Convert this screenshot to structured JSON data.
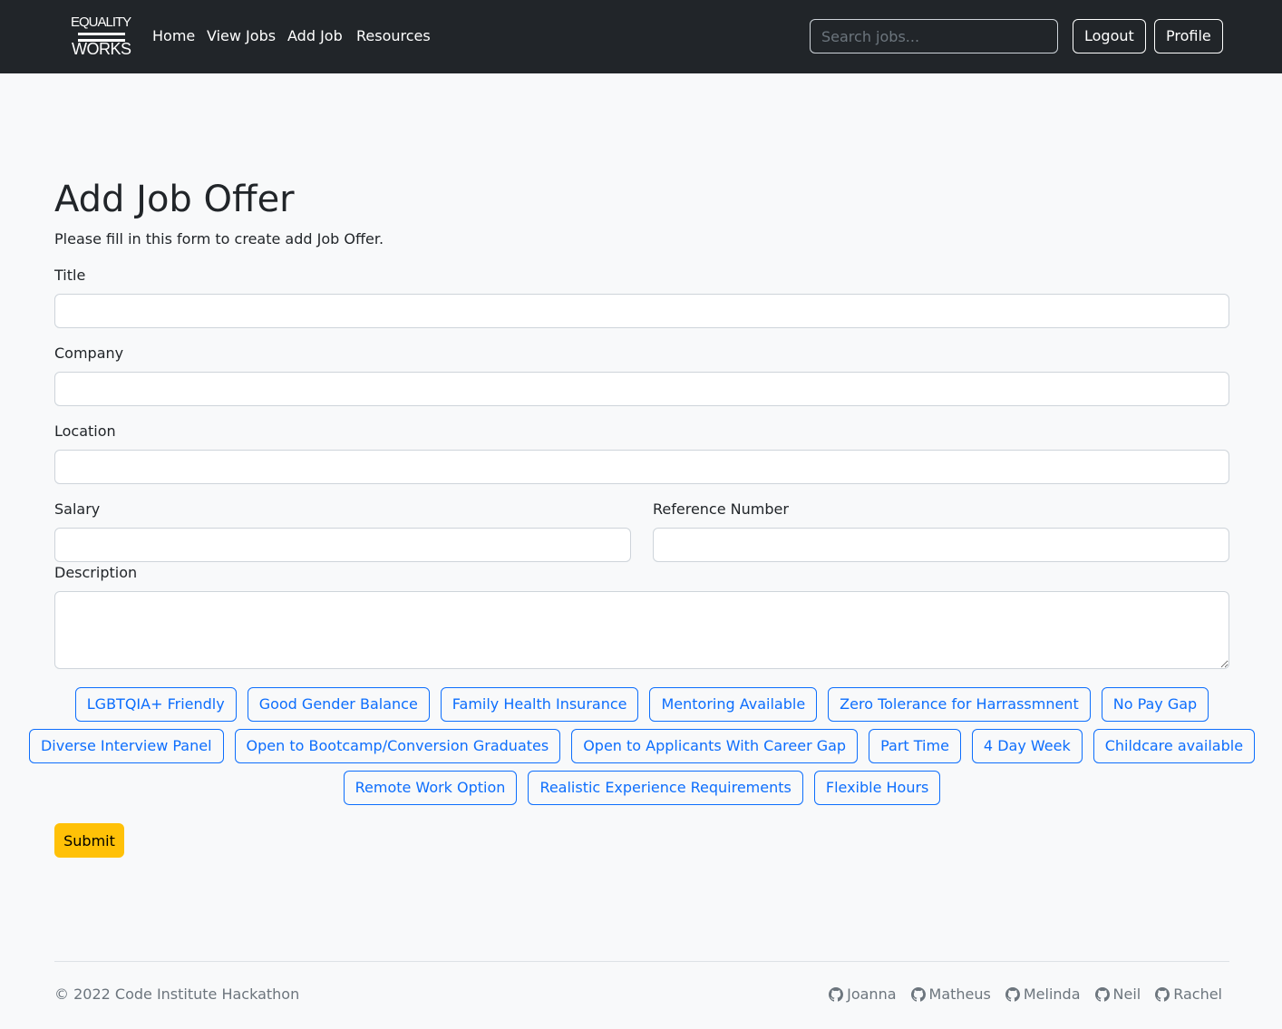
{
  "brand": {
    "line1": "EQUALITY",
    "line2": "WORKS"
  },
  "nav": {
    "links": [
      "Home",
      "View Jobs",
      "Add Job",
      "Resources"
    ],
    "search_placeholder": "Search jobs...",
    "logout": "Logout",
    "profile": "Profile"
  },
  "page": {
    "title": "Add Job Offer",
    "intro": "Please fill in this form to create add Job Offer."
  },
  "form": {
    "title_label": "Title",
    "company_label": "Company",
    "location_label": "Location",
    "salary_label": "Salary",
    "reference_label": "Reference Number",
    "description_label": "Description",
    "title_value": "",
    "company_value": "",
    "location_value": "",
    "salary_value": "",
    "reference_value": "",
    "description_value": "",
    "tags": [
      [
        "LGBTQIA+ Friendly",
        "Good Gender Balance",
        "Family Health Insurance",
        "Mentoring Available",
        "Zero Tolerance for Harrassmnent",
        "No Pay Gap"
      ],
      [
        "Diverse Interview Panel",
        "Open to Bootcamp/Conversion Graduates",
        "Open to Applicants With Career Gap",
        "Part Time",
        "4 Day Week",
        "Childcare available"
      ],
      [
        "Remote Work Option",
        "Realistic Experience Requirements",
        "Flexible Hours"
      ]
    ],
    "submit": "Submit"
  },
  "footer": {
    "copyright": "© 2022 Code Institute Hackathon",
    "contributors": [
      "Joanna",
      "Matheus",
      "Melinda",
      "Neil",
      "Rachel"
    ]
  },
  "colors": {
    "navbar": "#212529",
    "page_background": "#f8f9fa",
    "accent": "#0d6efd",
    "submit": "#ffc107"
  }
}
